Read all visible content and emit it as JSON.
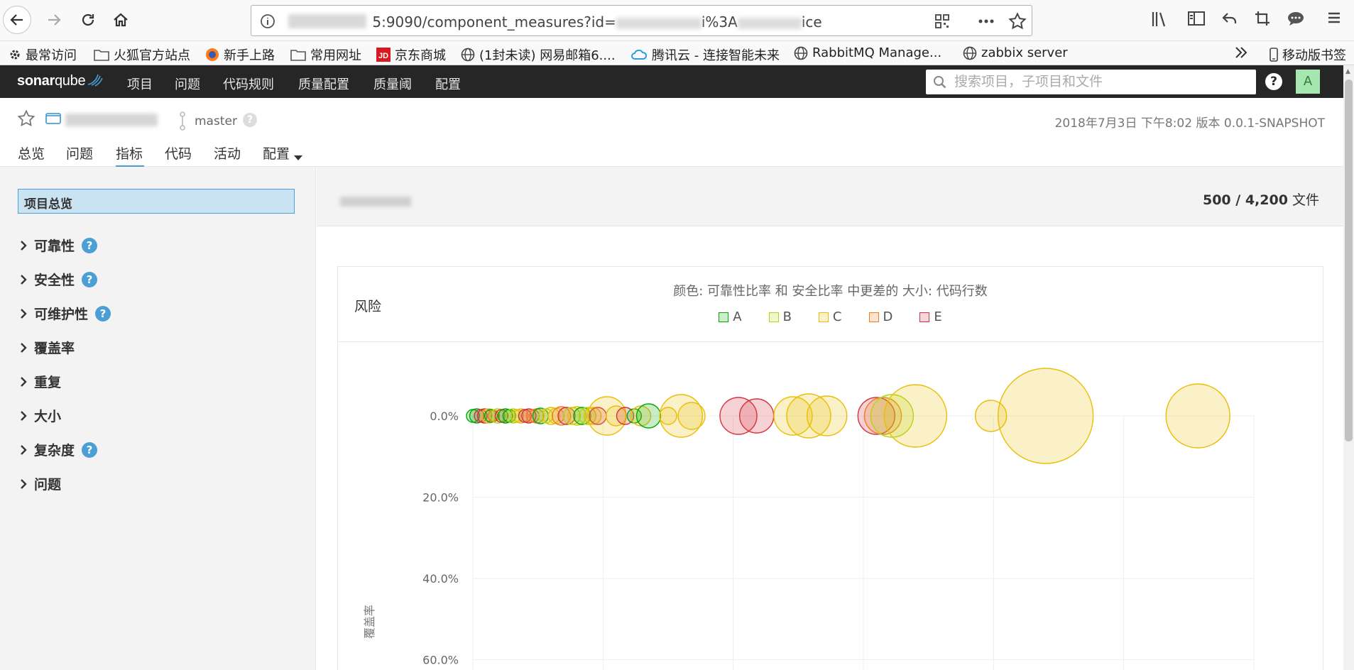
{
  "browser": {
    "url_visible": "5:9090/component_measures?id=",
    "url_tail": "i%3A",
    "url_tail2": "ice"
  },
  "bookmarks": [
    {
      "label": "最常访问",
      "icon": "gear-icon"
    },
    {
      "label": "火狐官方站点",
      "icon": "folder-icon"
    },
    {
      "label": "新手上路",
      "icon": "firefox-icon"
    },
    {
      "label": "常用网址",
      "icon": "folder-icon"
    },
    {
      "label": "京东商城",
      "icon": "jd-icon"
    },
    {
      "label": "(1封未读) 网易邮箱6....",
      "icon": "globe-icon"
    },
    {
      "label": "腾讯云 - 连接智能未来",
      "icon": "cloud-icon"
    },
    {
      "label": "RabbitMQ Manage...",
      "icon": "globe-icon"
    },
    {
      "label": "zabbix server",
      "icon": "globe-icon"
    },
    {
      "label": "移动版书签",
      "icon": "mobile-icon"
    }
  ],
  "sonar": {
    "logo_a": "sonar",
    "logo_b": "qube",
    "menu": [
      "项目",
      "问题",
      "代码规则",
      "质量配置",
      "质量阈",
      "配置"
    ],
    "search_placeholder": "搜索项目，子项目和文件",
    "help": "?",
    "avatar": "A"
  },
  "project": {
    "branch": "master",
    "meta": "2018年7月3日 下午8:02   版本 0.0.1-SNAPSHOT",
    "tabs": [
      "总览",
      "问题",
      "指标",
      "代码",
      "活动",
      "配置"
    ]
  },
  "sidebar": {
    "overview": "项目总览",
    "items": [
      {
        "label": "可靠性",
        "help": true
      },
      {
        "label": "安全性",
        "help": true
      },
      {
        "label": "可维护性",
        "help": true
      },
      {
        "label": "覆盖率",
        "help": false
      },
      {
        "label": "重复",
        "help": false
      },
      {
        "label": "大小",
        "help": false
      },
      {
        "label": "复杂度",
        "help": true
      },
      {
        "label": "问题",
        "help": false
      }
    ]
  },
  "main": {
    "files_shown": "500",
    "files_total": "4,200",
    "files_unit": "文件"
  },
  "chart_data": {
    "type": "scatter",
    "title": "风险",
    "description": "颜色: 可靠性比率 和 安全比率 中更差的  大小: 代码行数",
    "legend": [
      {
        "label": "A",
        "color": "#00aa00"
      },
      {
        "label": "B",
        "color": "#b0d513"
      },
      {
        "label": "C",
        "color": "#eabe06"
      },
      {
        "label": "D",
        "color": "#ed7d20"
      },
      {
        "label": "E",
        "color": "#d4333f"
      }
    ],
    "ylabel": "覆盖率",
    "ylim": [
      0,
      60
    ],
    "y_ticks": [
      "0.0%",
      "20.0%",
      "40.0%",
      "60.0%"
    ],
    "xlim": [
      0,
      6
    ],
    "points": [
      {
        "x": 0.0,
        "y": 0,
        "r": 9,
        "rating": "A"
      },
      {
        "x": 0.03,
        "y": 0,
        "r": 10,
        "rating": "A"
      },
      {
        "x": 0.06,
        "y": 0,
        "r": 9,
        "rating": "E"
      },
      {
        "x": 0.09,
        "y": 0,
        "r": 10,
        "rating": "E"
      },
      {
        "x": 0.12,
        "y": 0,
        "r": 10,
        "rating": "C"
      },
      {
        "x": 0.14,
        "y": 0,
        "r": 9,
        "rating": "A"
      },
      {
        "x": 0.16,
        "y": 0,
        "r": 8,
        "rating": "D"
      },
      {
        "x": 0.19,
        "y": 0,
        "r": 10,
        "rating": "B"
      },
      {
        "x": 0.22,
        "y": 0,
        "r": 9,
        "rating": "E"
      },
      {
        "x": 0.25,
        "y": 0,
        "r": 10,
        "rating": "A"
      },
      {
        "x": 0.28,
        "y": 0,
        "r": 9,
        "rating": "A"
      },
      {
        "x": 0.31,
        "y": 0,
        "r": 10,
        "rating": "B"
      },
      {
        "x": 0.34,
        "y": 0,
        "r": 9,
        "rating": "C"
      },
      {
        "x": 0.37,
        "y": 0,
        "r": 10,
        "rating": "C"
      },
      {
        "x": 0.4,
        "y": 0,
        "r": 9,
        "rating": "E"
      },
      {
        "x": 0.43,
        "y": 0,
        "r": 10,
        "rating": "E"
      },
      {
        "x": 0.46,
        "y": 0,
        "r": 9,
        "rating": "D"
      },
      {
        "x": 0.49,
        "y": 0,
        "r": 10,
        "rating": "D"
      },
      {
        "x": 0.52,
        "y": 0,
        "r": 11,
        "rating": "A"
      },
      {
        "x": 0.56,
        "y": 0,
        "r": 10,
        "rating": "B"
      },
      {
        "x": 0.6,
        "y": 0,
        "r": 12,
        "rating": "C"
      },
      {
        "x": 0.64,
        "y": 0,
        "r": 11,
        "rating": "C"
      },
      {
        "x": 0.68,
        "y": 0,
        "r": 13,
        "rating": "D"
      },
      {
        "x": 0.72,
        "y": 0,
        "r": 12,
        "rating": "E"
      },
      {
        "x": 0.76,
        "y": 0,
        "r": 12,
        "rating": "B"
      },
      {
        "x": 0.8,
        "y": 0,
        "r": 13,
        "rating": "C"
      },
      {
        "x": 0.84,
        "y": 0,
        "r": 12,
        "rating": "A"
      },
      {
        "x": 0.88,
        "y": 0,
        "r": 12,
        "rating": "B"
      },
      {
        "x": 0.92,
        "y": 0,
        "r": 12,
        "rating": "C"
      },
      {
        "x": 0.96,
        "y": 0,
        "r": 12,
        "rating": "E"
      },
      {
        "x": 1.03,
        "y": 0,
        "r": 27,
        "rating": "C"
      },
      {
        "x": 1.1,
        "y": 0,
        "r": 14,
        "rating": "C"
      },
      {
        "x": 1.17,
        "y": 0,
        "r": 12,
        "rating": "E"
      },
      {
        "x": 1.24,
        "y": 0,
        "r": 10,
        "rating": "A"
      },
      {
        "x": 1.29,
        "y": 0,
        "r": 14,
        "rating": "C"
      },
      {
        "x": 1.35,
        "y": 0,
        "r": 17,
        "rating": "A"
      },
      {
        "x": 1.5,
        "y": 0,
        "r": 12,
        "rating": "C"
      },
      {
        "x": 1.6,
        "y": 0,
        "r": 30,
        "rating": "C"
      },
      {
        "x": 1.68,
        "y": 0,
        "r": 19,
        "rating": "C"
      },
      {
        "x": 2.04,
        "y": 0,
        "r": 26,
        "rating": "E"
      },
      {
        "x": 2.18,
        "y": 0,
        "r": 24,
        "rating": "E"
      },
      {
        "x": 2.46,
        "y": 0,
        "r": 27,
        "rating": "C"
      },
      {
        "x": 2.58,
        "y": 0,
        "r": 31,
        "rating": "C"
      },
      {
        "x": 2.72,
        "y": 0,
        "r": 28,
        "rating": "C"
      },
      {
        "x": 3.1,
        "y": 0,
        "r": 26,
        "rating": "E"
      },
      {
        "x": 3.15,
        "y": 0,
        "r": 26,
        "rating": "D"
      },
      {
        "x": 3.22,
        "y": 0,
        "r": 30,
        "rating": "B"
      },
      {
        "x": 3.4,
        "y": 0,
        "r": 44,
        "rating": "C"
      },
      {
        "x": 3.98,
        "y": 0,
        "r": 22,
        "rating": "C"
      },
      {
        "x": 4.4,
        "y": 0,
        "r": 67,
        "rating": "C"
      },
      {
        "x": 5.57,
        "y": 0,
        "r": 45,
        "rating": "C"
      }
    ]
  }
}
